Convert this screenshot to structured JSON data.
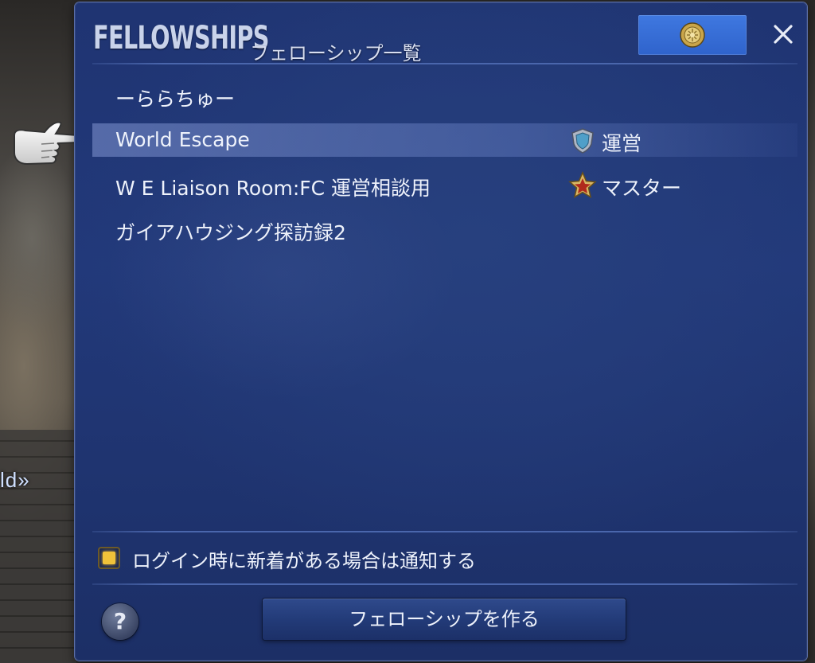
{
  "background": {
    "partial_text": "ld»"
  },
  "window": {
    "title_main": "FELLOWSHIPS",
    "title_sub": "フェローシップ一覧",
    "close_icon": "close-icon",
    "emblem_icon": "fellowship-emblem-icon"
  },
  "fellowships": [
    {
      "name": "ーららちゅー",
      "role": "",
      "role_icon": ""
    },
    {
      "name": "World Escape",
      "role": "運営",
      "role_icon": "shield-rank-icon",
      "selected": true
    },
    {
      "name": "W E Liaison Room:FC 運営相談用",
      "role": "マスター",
      "role_icon": "star-rank-icon"
    },
    {
      "name": "ガイアハウジング探訪録2",
      "role": "",
      "role_icon": ""
    }
  ],
  "notify": {
    "label": "ログイン時に新着がある場合は通知する",
    "checked": true
  },
  "footer": {
    "help_label": "?",
    "create_label": "フェローシップを作る"
  },
  "colors": {
    "window_bg": "#22397a",
    "emblem_button": "#3a70da",
    "checkbox_fill": "#f0c23a",
    "text": "#eef2fb"
  }
}
